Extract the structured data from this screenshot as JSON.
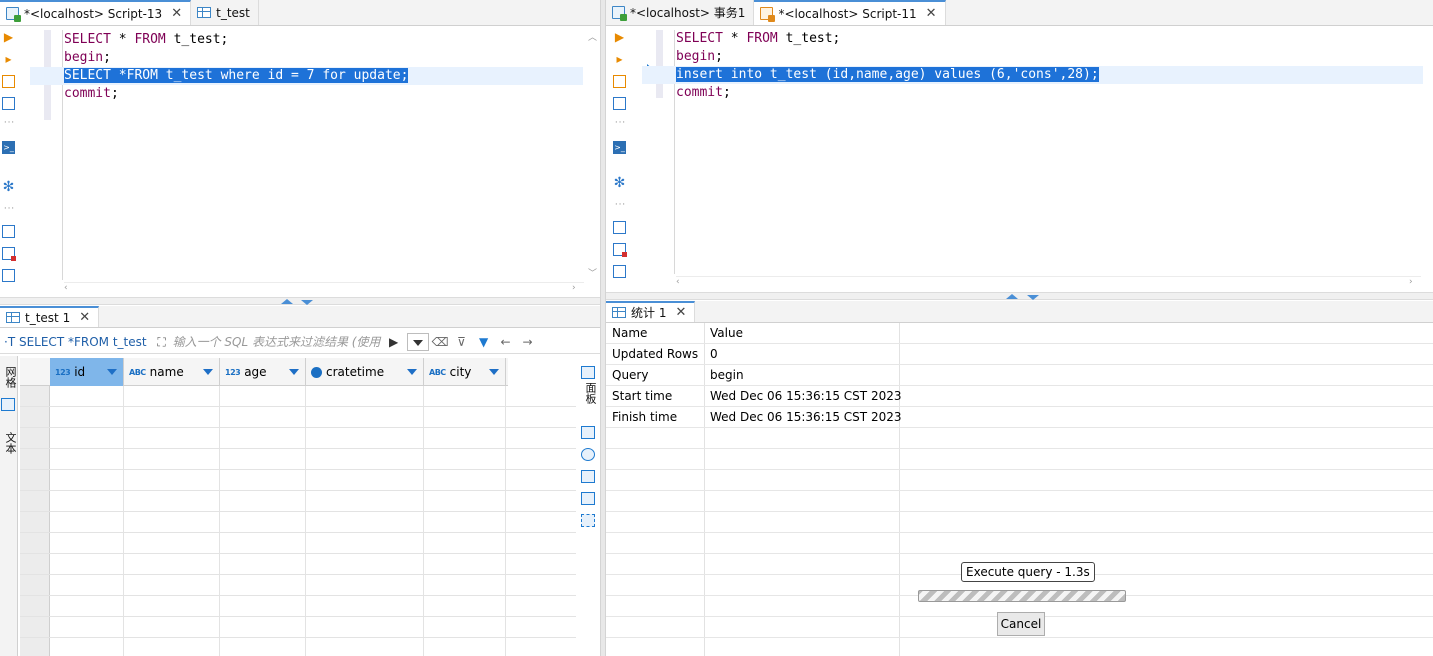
{
  "left": {
    "tabs": [
      {
        "label": "*<localhost> Script-13",
        "closable": true,
        "active": true,
        "icon": "sql-script-icon"
      },
      {
        "label": "t_test",
        "closable": false,
        "active": false,
        "icon": "table-icon"
      }
    ],
    "editor": {
      "lines": [
        {
          "parts": [
            {
              "t": "SELECT",
              "kw": true
            },
            {
              "t": " * "
            },
            {
              "t": "FROM",
              "kw": true
            },
            {
              "t": " t_test;"
            }
          ]
        },
        {
          "parts": [
            {
              "t": "begin",
              "kw": true
            },
            {
              "t": ";"
            }
          ]
        },
        {
          "parts": [
            {
              "t": "SELECT",
              "kw": true
            },
            {
              "t": " *"
            },
            {
              "t": "FROM",
              "kw": true
            },
            {
              "t": " t_test "
            },
            {
              "t": "where",
              "kw": true
            },
            {
              "t": " id = 7 "
            },
            {
              "t": "for",
              "kw": true
            },
            {
              "t": " "
            },
            {
              "t": "update",
              "kw": true
            },
            {
              "t": ";"
            }
          ],
          "selected": true
        },
        {
          "parts": [
            {
              "t": "commit",
              "kw": true
            },
            {
              "t": ";"
            }
          ]
        }
      ]
    },
    "results": {
      "tab_label": "t_test 1",
      "query_label": "SELECT *FROM t_test",
      "filter_placeholder": "输入一个 SQL 表达式来过滤结果 (使用",
      "vtab_grid": "网格",
      "vtab_text": "文本",
      "right_vtab": "面板",
      "columns": [
        {
          "label": "id",
          "type_badge": "123",
          "selected": true
        },
        {
          "label": "name",
          "type_badge": "ABC",
          "selected": false
        },
        {
          "label": "age",
          "type_badge": "123",
          "selected": false
        },
        {
          "label": "cratetime",
          "type_badge": "time",
          "selected": false
        },
        {
          "label": "city",
          "type_badge": "ABC",
          "selected": false
        }
      ],
      "empty_rows": 13
    }
  },
  "right": {
    "tabs": [
      {
        "label": "*<localhost> 事务1",
        "closable": false,
        "active": false,
        "icon": "sql-script-icon"
      },
      {
        "label": "*<localhost> Script-11",
        "closable": true,
        "active": true,
        "icon": "sql-script-orange-icon"
      }
    ],
    "editor": {
      "lines": [
        {
          "parts": [
            {
              "t": "SELECT",
              "kw": true
            },
            {
              "t": " * "
            },
            {
              "t": "FROM",
              "kw": true
            },
            {
              "t": " t_test;"
            }
          ]
        },
        {
          "parts": [
            {
              "t": "begin",
              "kw": true
            },
            {
              "t": ";"
            }
          ]
        },
        {
          "parts": [
            {
              "t": "insert",
              "kw": true
            },
            {
              "t": " "
            },
            {
              "t": "into",
              "kw": true
            },
            {
              "t": " t_test (id,name,age) "
            },
            {
              "t": "values",
              "kw": true
            },
            {
              "t": " (6,'cons',28);"
            }
          ],
          "selected": true
        },
        {
          "parts": [
            {
              "t": "commit",
              "kw": true
            },
            {
              "t": ";"
            }
          ]
        }
      ]
    },
    "stats": {
      "tab_label": "统计 1",
      "header": {
        "name": "Name",
        "value": "Value"
      },
      "rows": [
        {
          "name": "Updated Rows",
          "value": "0"
        },
        {
          "name": "Query",
          "value": "begin"
        },
        {
          "name": "Start time",
          "value": "Wed Dec 06 15:36:15 CST 2023"
        },
        {
          "name": "Finish time",
          "value": "Wed Dec 06 15:36:15 CST 2023"
        }
      ],
      "empty_rows": 10
    },
    "execution": {
      "tooltip": "Execute query - 1.3s",
      "cancel_label": "Cancel"
    }
  }
}
